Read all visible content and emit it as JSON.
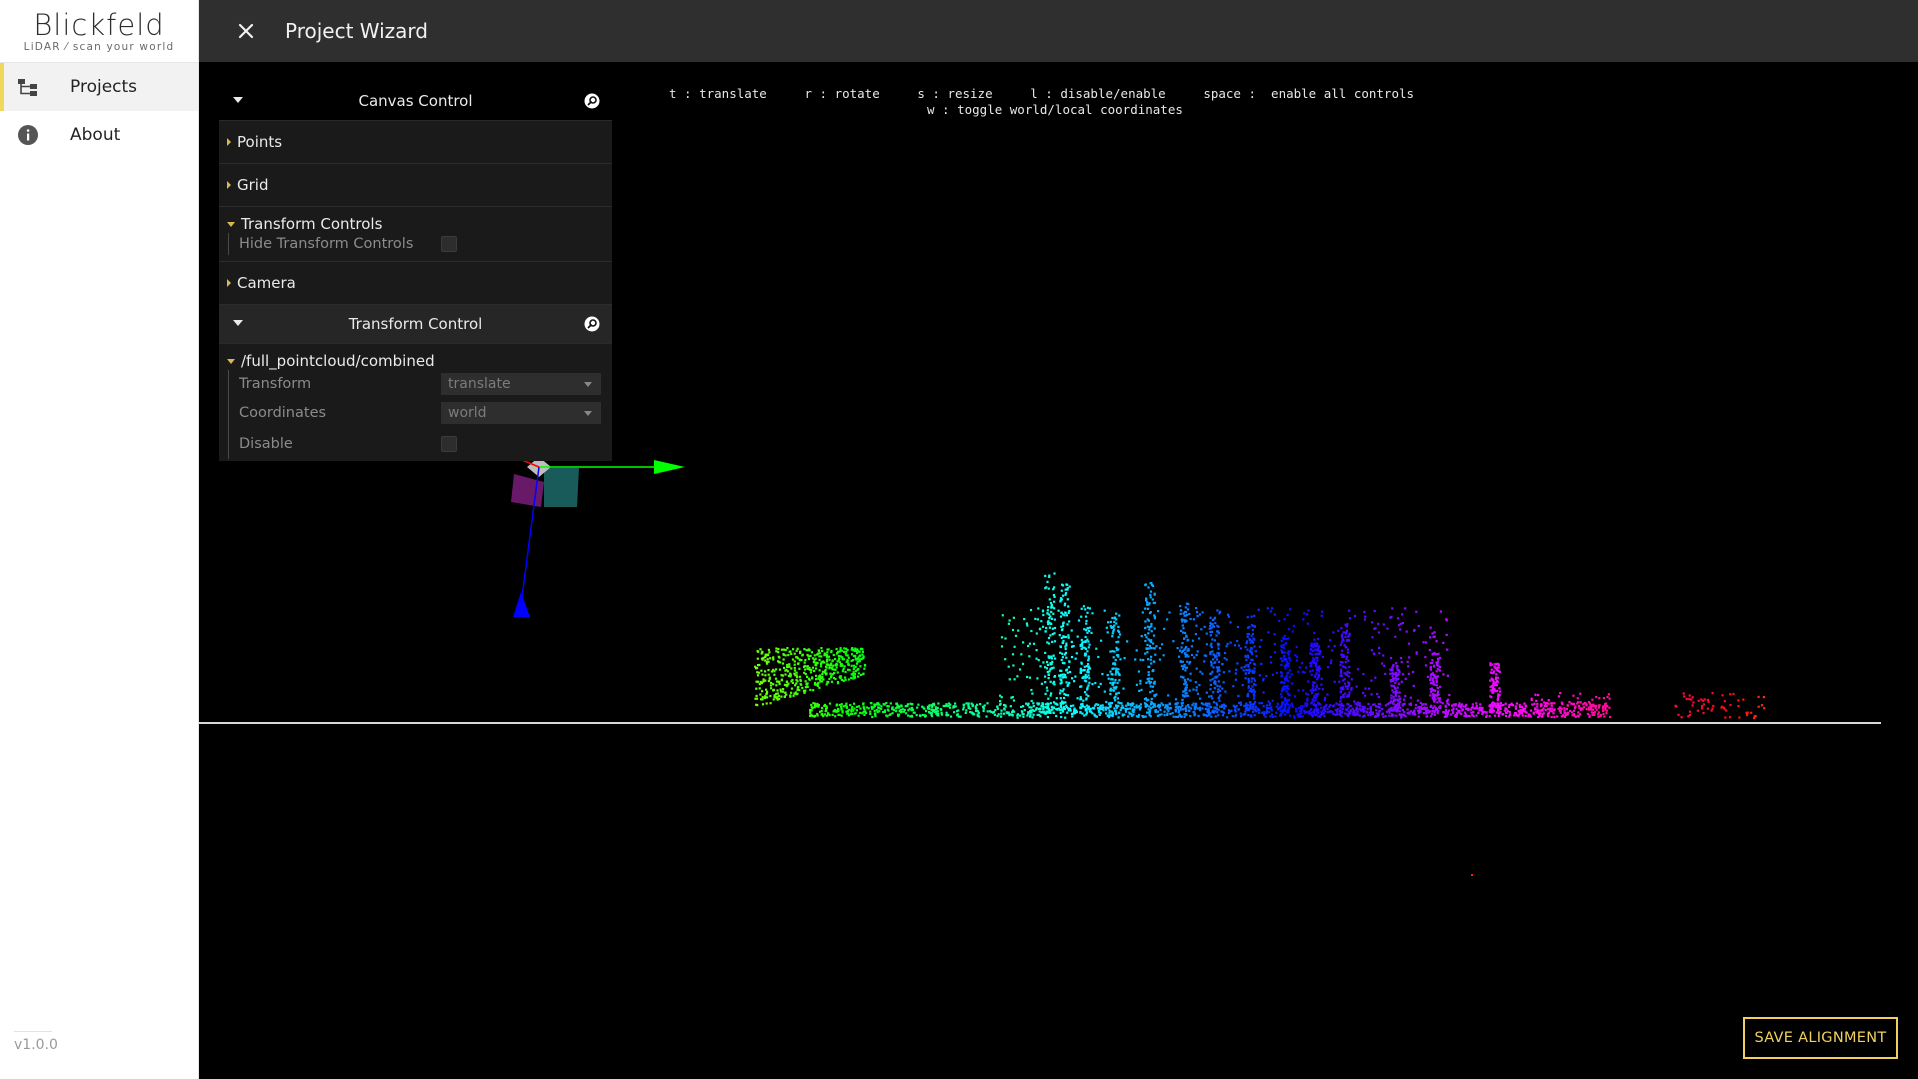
{
  "app": {
    "logo_wordmark": "Blickfeld",
    "logo_tagline": "LiDAR ⁄ scan your world",
    "version": "v1.0.0"
  },
  "sidebar": {
    "items": [
      {
        "label": "Projects",
        "icon": "project-tree-icon",
        "active": true
      },
      {
        "label": "About",
        "icon": "info-icon",
        "active": false
      }
    ]
  },
  "header": {
    "title": "Project Wizard",
    "close_icon": "close-icon"
  },
  "hint": {
    "line1": "t : translate     r : rotate     s : resize     l : disable/enable     space :  enable all controls",
    "line2": "w : toggle world/local coordinates"
  },
  "canvas_control": {
    "title": "Canvas Control",
    "folders": {
      "points": "Points",
      "grid": "Grid",
      "transform_controls": "Transform Controls",
      "hide_transform_controls": "Hide Transform Controls",
      "camera": "Camera"
    }
  },
  "transform_control": {
    "title": "Transform Control",
    "folder": "/full_pointcloud/combined",
    "transform_label": "Transform",
    "transform_value": "translate",
    "coordinates_label": "Coordinates",
    "coordinates_value": "world",
    "disable_label": "Disable"
  },
  "save_button": "SAVE ALIGNMENT",
  "colors": {
    "accent": "#f1d15d",
    "header_bg": "#2f2f2f",
    "axis_x": "#ff0000",
    "axis_y": "#00ff00",
    "axis_z": "#0000ff"
  }
}
